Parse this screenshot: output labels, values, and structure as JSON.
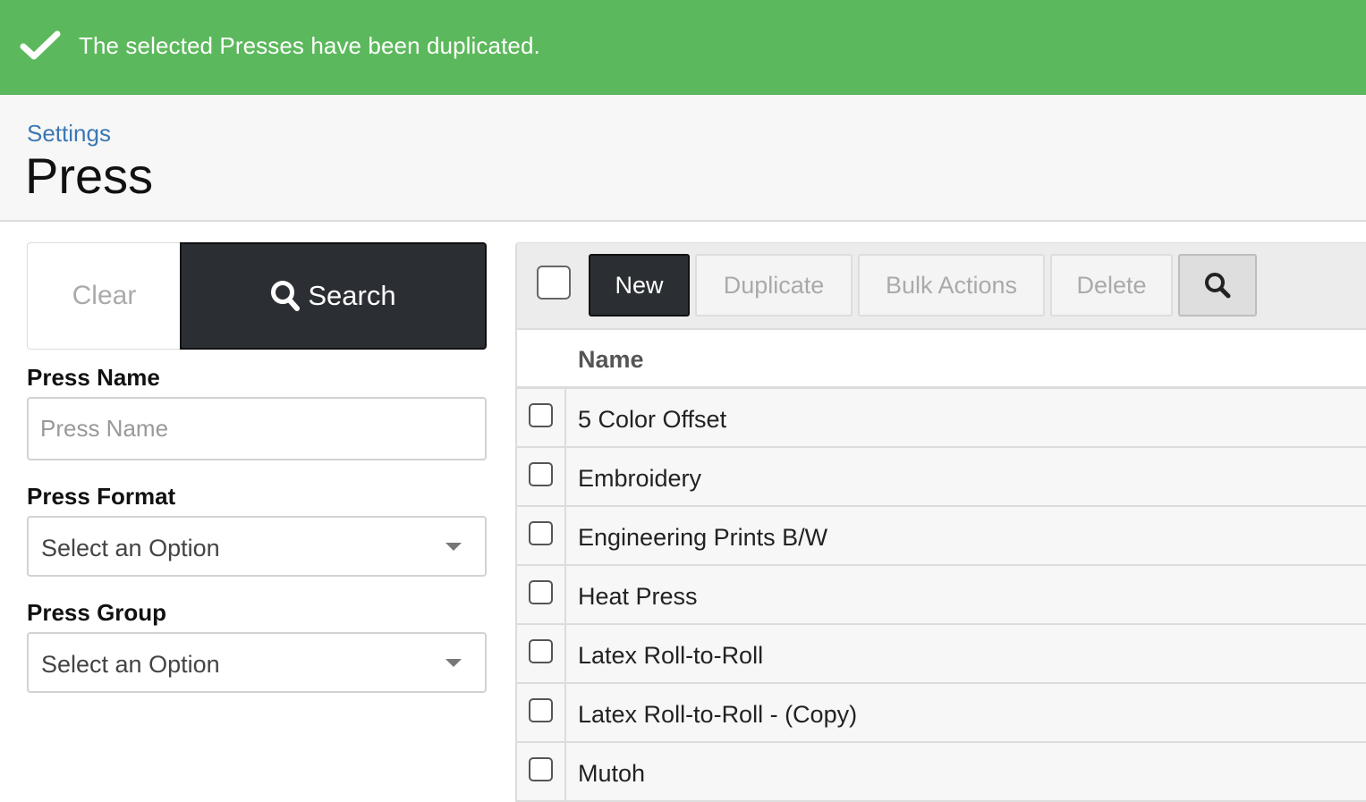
{
  "alert": {
    "icon": "check-icon",
    "message": "The selected Presses have been duplicated.",
    "color": "#5cb85c"
  },
  "header": {
    "breadcrumb": "Settings",
    "title": "Press"
  },
  "filters": {
    "clear_label": "Clear",
    "search_label": "Search",
    "press_name": {
      "label": "Press Name",
      "placeholder": "Press Name",
      "value": ""
    },
    "press_format": {
      "label": "Press Format",
      "value": "Select an Option"
    },
    "press_group": {
      "label": "Press Group",
      "value": "Select an Option"
    }
  },
  "toolbar": {
    "new_label": "New",
    "duplicate_label": "Duplicate",
    "bulk_actions_label": "Bulk Actions",
    "delete_label": "Delete",
    "search_icon": "search-icon"
  },
  "table": {
    "column_name": "Name",
    "rows": [
      "5 Color Offset",
      "Embroidery",
      "Engineering Prints B/W",
      "Heat Press",
      "Latex Roll-to-Roll",
      "Latex Roll-to-Roll - (Copy)",
      "Mutoh"
    ]
  }
}
